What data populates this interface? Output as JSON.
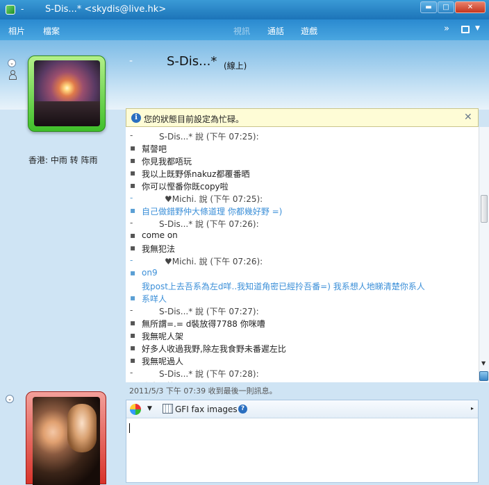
{
  "window": {
    "title_dash": "-",
    "title": "S-Dis...* <skydis@live.hk>",
    "min": "▬",
    "max": "□",
    "close": "✕"
  },
  "menu": {
    "left": [
      "相片",
      "檔案"
    ],
    "dim": "視訊",
    "center": [
      "通話",
      "遊戲"
    ],
    "more": "»",
    "tools_arrow": "▼"
  },
  "header": {
    "dash": "-",
    "contact_name": "S-Dis...*",
    "contact_status": "(線上)"
  },
  "sidebar": {
    "weather": "香港: 中雨 转 阵雨",
    "expand_glyph": "⌄"
  },
  "notification": {
    "icon_glyph": "i",
    "text": "您的狀態目前設定為忙碌。",
    "close": "✕"
  },
  "chat": {
    "lines": [
      {
        "kind": "sender",
        "mark": "-",
        "text": "S-Dis...* 說 (下午 07:25):"
      },
      {
        "kind": "msg",
        "mark": "▪",
        "text": "幫謦吧"
      },
      {
        "kind": "msg",
        "mark": "▪",
        "text": "你見我都唔玩"
      },
      {
        "kind": "msg",
        "mark": "▪",
        "text": "我以上既野係nakuz都覆番晒"
      },
      {
        "kind": "msg",
        "mark": "▪",
        "text": "你可以慳番你既copy啦"
      },
      {
        "kind": "michi",
        "mark": "-",
        "text": "♥Michi. 說 (下午 07:25):"
      },
      {
        "kind": "blue",
        "mark": "▪",
        "text": "自己做錯野仲大條道理 你都幾好野 =)"
      },
      {
        "kind": "sender",
        "mark": "-",
        "text": "S-Dis...* 說 (下午 07:26):"
      },
      {
        "kind": "msg",
        "mark": "▪",
        "text": "come on"
      },
      {
        "kind": "msg",
        "mark": "▪",
        "text": "我無犯法"
      },
      {
        "kind": "michi",
        "mark": "-",
        "text": "♥Michi. 說 (下午 07:26):"
      },
      {
        "kind": "blue",
        "mark": "▪",
        "text": "on9"
      },
      {
        "kind": "cont",
        "mark": "",
        "text": "我post上去吾系為左d咩..我知道角密已經拎吾番=) 我系想人地睇清楚你系人"
      },
      {
        "kind": "blue",
        "mark": "▪",
        "text": "系咩人"
      },
      {
        "kind": "sender",
        "mark": "-",
        "text": "S-Dis...* 說 (下午 07:27):"
      },
      {
        "kind": "msg",
        "mark": "▪",
        "text": "無所謂=.= d裝放得7788 你咪嘈"
      },
      {
        "kind": "msg",
        "mark": "▪",
        "text": "我無呢人架"
      },
      {
        "kind": "msg",
        "mark": "▪",
        "text": "好多人收過我野,除左我食野未番遲左比"
      },
      {
        "kind": "msg",
        "mark": "▪",
        "text": "我無呢過人"
      },
      {
        "kind": "sender",
        "mark": "-",
        "text": "S-Dis...* 說 (下午 07:28):"
      },
      {
        "kind": "msg",
        "mark": "▪",
        "text": "我走既等!"
      }
    ]
  },
  "status_line": "2011/5/3 下午 07:39 收到最後一則訊息。",
  "compose": {
    "emoticon_arrow": "▼",
    "gfi_label": "GFI fax images",
    "help_glyph": "?",
    "more_arrow": "▸"
  },
  "scrollbar": {
    "down_arrow": "▼"
  },
  "colors": {
    "accent": "#2a8ad0",
    "link_blue": "#3b8fd8",
    "notify_bg": "#fefcd6"
  }
}
